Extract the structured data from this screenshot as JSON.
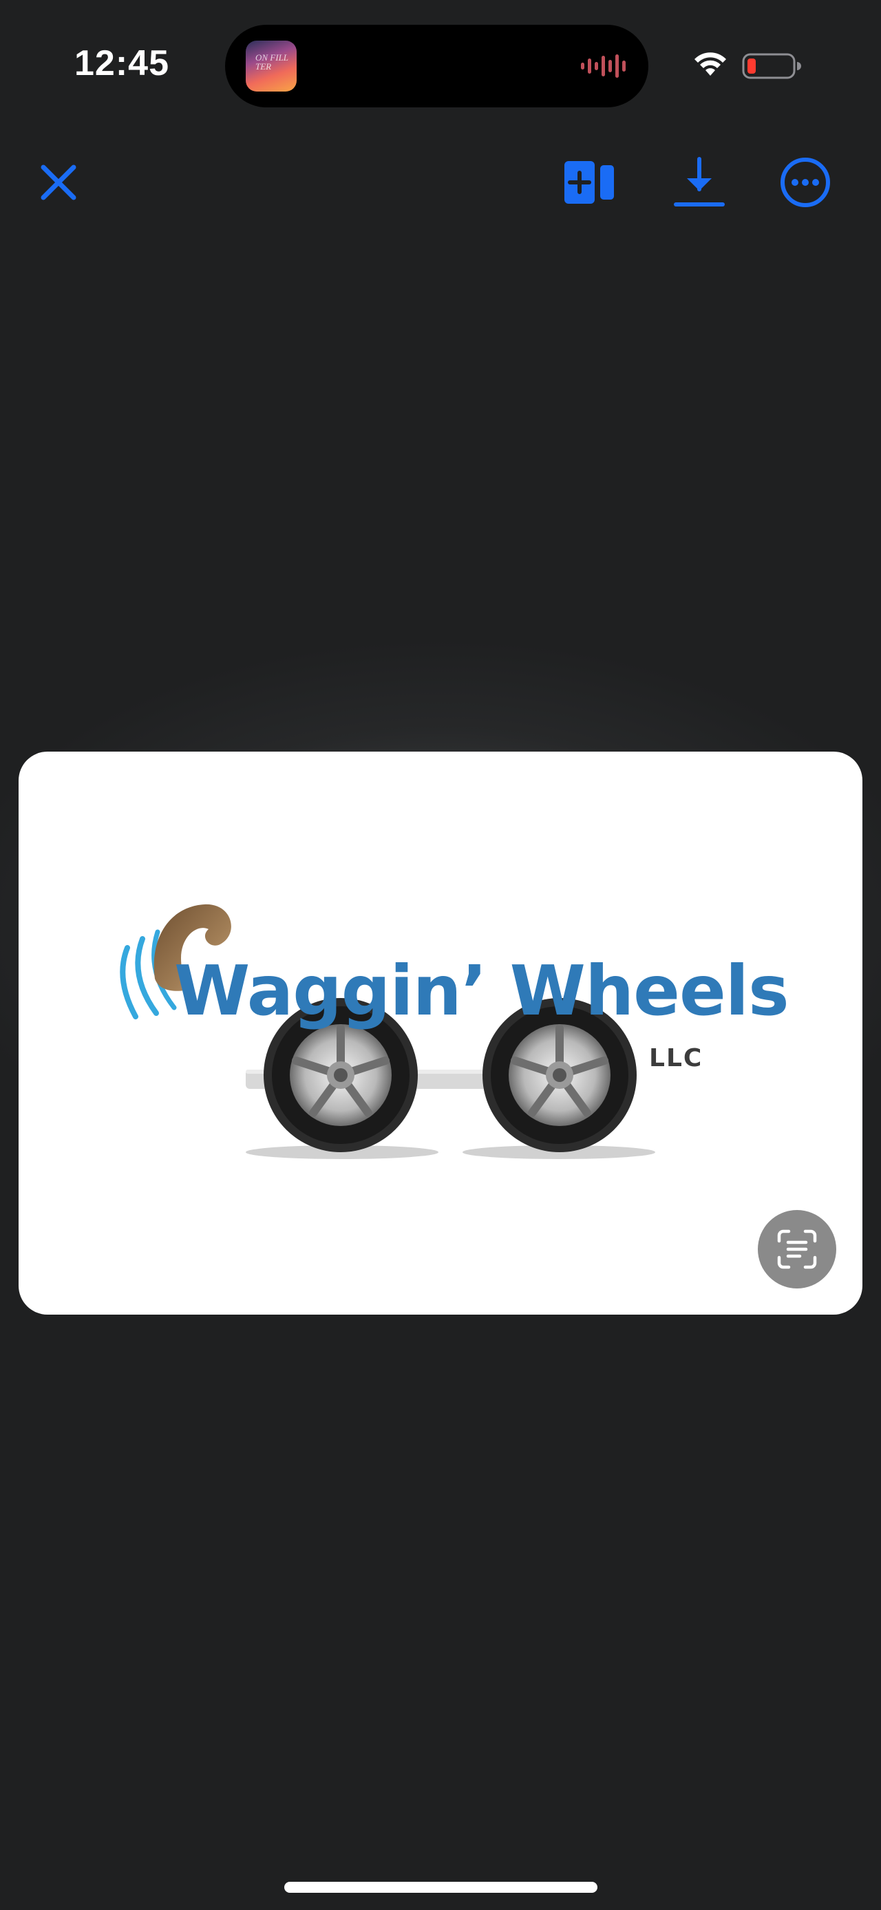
{
  "status_bar": {
    "time": "12:45",
    "now_playing_art_text": "ON FILL TER",
    "wifi_icon": "wifi-icon",
    "battery_icon": "battery-low-icon",
    "battery_color": "#ff3b30"
  },
  "toolbar": {
    "close_icon": "close-icon",
    "live_photo_icon": "add-to-live-photo-icon",
    "save_icon": "download-icon",
    "more_icon": "ellipsis-circle-icon",
    "accent_color": "#1a6cf5"
  },
  "image": {
    "brand_name": "Waggin’ Wheels",
    "suffix": "LLC",
    "brand_color": "#2f7ab8",
    "tail_color": "#8b6a45",
    "motion_lines_color": "#35a8de"
  },
  "live_text_button": {
    "icon": "live-text-scan-icon"
  }
}
